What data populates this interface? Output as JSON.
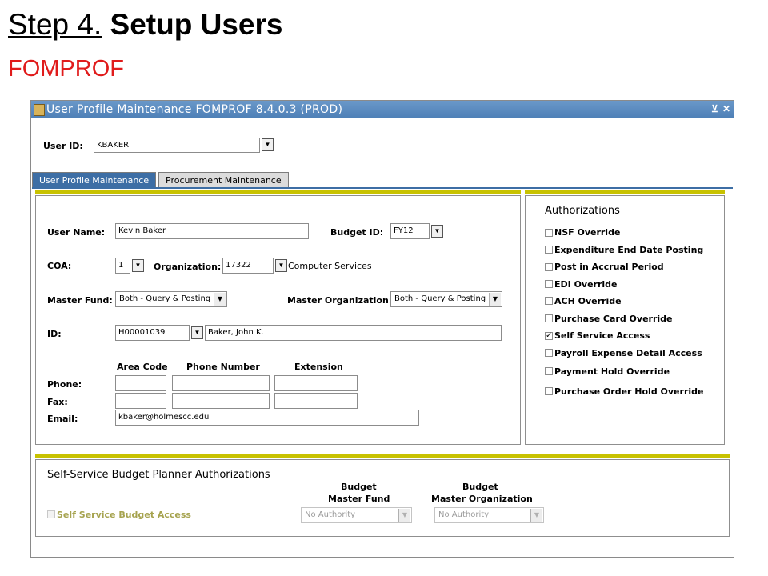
{
  "slide": {
    "step_prefix": "Step 4.",
    "step_title": "Setup Users",
    "subtitle": "FOMPROF"
  },
  "window": {
    "title": "User Profile Maintenance  FOMPROF  8.4.0.3  (PROD)",
    "minimize_glyph": "⊻",
    "close_glyph": "✕"
  },
  "key_block": {
    "user_id_label": "User ID:",
    "user_id_value": "KBAKER"
  },
  "tabs": [
    {
      "label": "User Profile Maintenance",
      "active": true
    },
    {
      "label": "Procurement Maintenance",
      "active": false
    }
  ],
  "profile": {
    "user_name_label": "User Name:",
    "user_name_value": "Kevin Baker",
    "budget_id_label": "Budget ID:",
    "budget_id_value": "FY12",
    "coa_label": "COA:",
    "coa_value": "1",
    "organization_label": "Organization:",
    "organization_value": "17322",
    "organization_desc": "Computer Services",
    "master_fund_label": "Master Fund:",
    "master_fund_value": "Both - Query & Posting",
    "master_org_label": "Master Organization:",
    "master_org_value": "Both - Query & Posting",
    "id_label": "ID:",
    "id_value": "H00001039",
    "id_name": "Baker, John K.",
    "area_code_header": "Area Code",
    "phone_number_header": "Phone Number",
    "extension_header": "Extension",
    "phone_label": "Phone:",
    "fax_label": "Fax:",
    "email_label": "Email:",
    "email_value": "kbaker@holmescc.edu"
  },
  "authorizations": {
    "heading": "Authorizations",
    "items": [
      {
        "label": "NSF Override",
        "checked": false
      },
      {
        "label": "Expenditure End Date Posting",
        "checked": false
      },
      {
        "label": "Post in Accrual Period",
        "checked": false
      },
      {
        "label": "EDI Override",
        "checked": false
      },
      {
        "label": "ACH Override",
        "checked": false
      },
      {
        "label": "Purchase Card Override",
        "checked": false
      },
      {
        "label": "Self Service Access",
        "checked": true
      },
      {
        "label": "Payroll Expense Detail Access",
        "checked": false
      },
      {
        "label": "Payment Hold Override",
        "checked": false
      },
      {
        "label": "Purchase Order Hold Override",
        "checked": false
      }
    ]
  },
  "budget_planner": {
    "heading": "Self-Service Budget Planner Authorizations",
    "access_label": "Self Service Budget Access",
    "fund_header_line1": "Budget",
    "fund_header_line2": "Master Fund",
    "org_header_line1": "Budget",
    "org_header_line2": "Master Organization",
    "fund_value": "No Authority",
    "org_value": "No Authority"
  },
  "glyphs": {
    "dropdown": "▼",
    "check": "✓"
  },
  "colors": {
    "title_bar": "#4d7fb6",
    "active_tab": "#3d6ea5",
    "section_bar": "#c8c200",
    "subtitle_red": "#e01b1b"
  }
}
